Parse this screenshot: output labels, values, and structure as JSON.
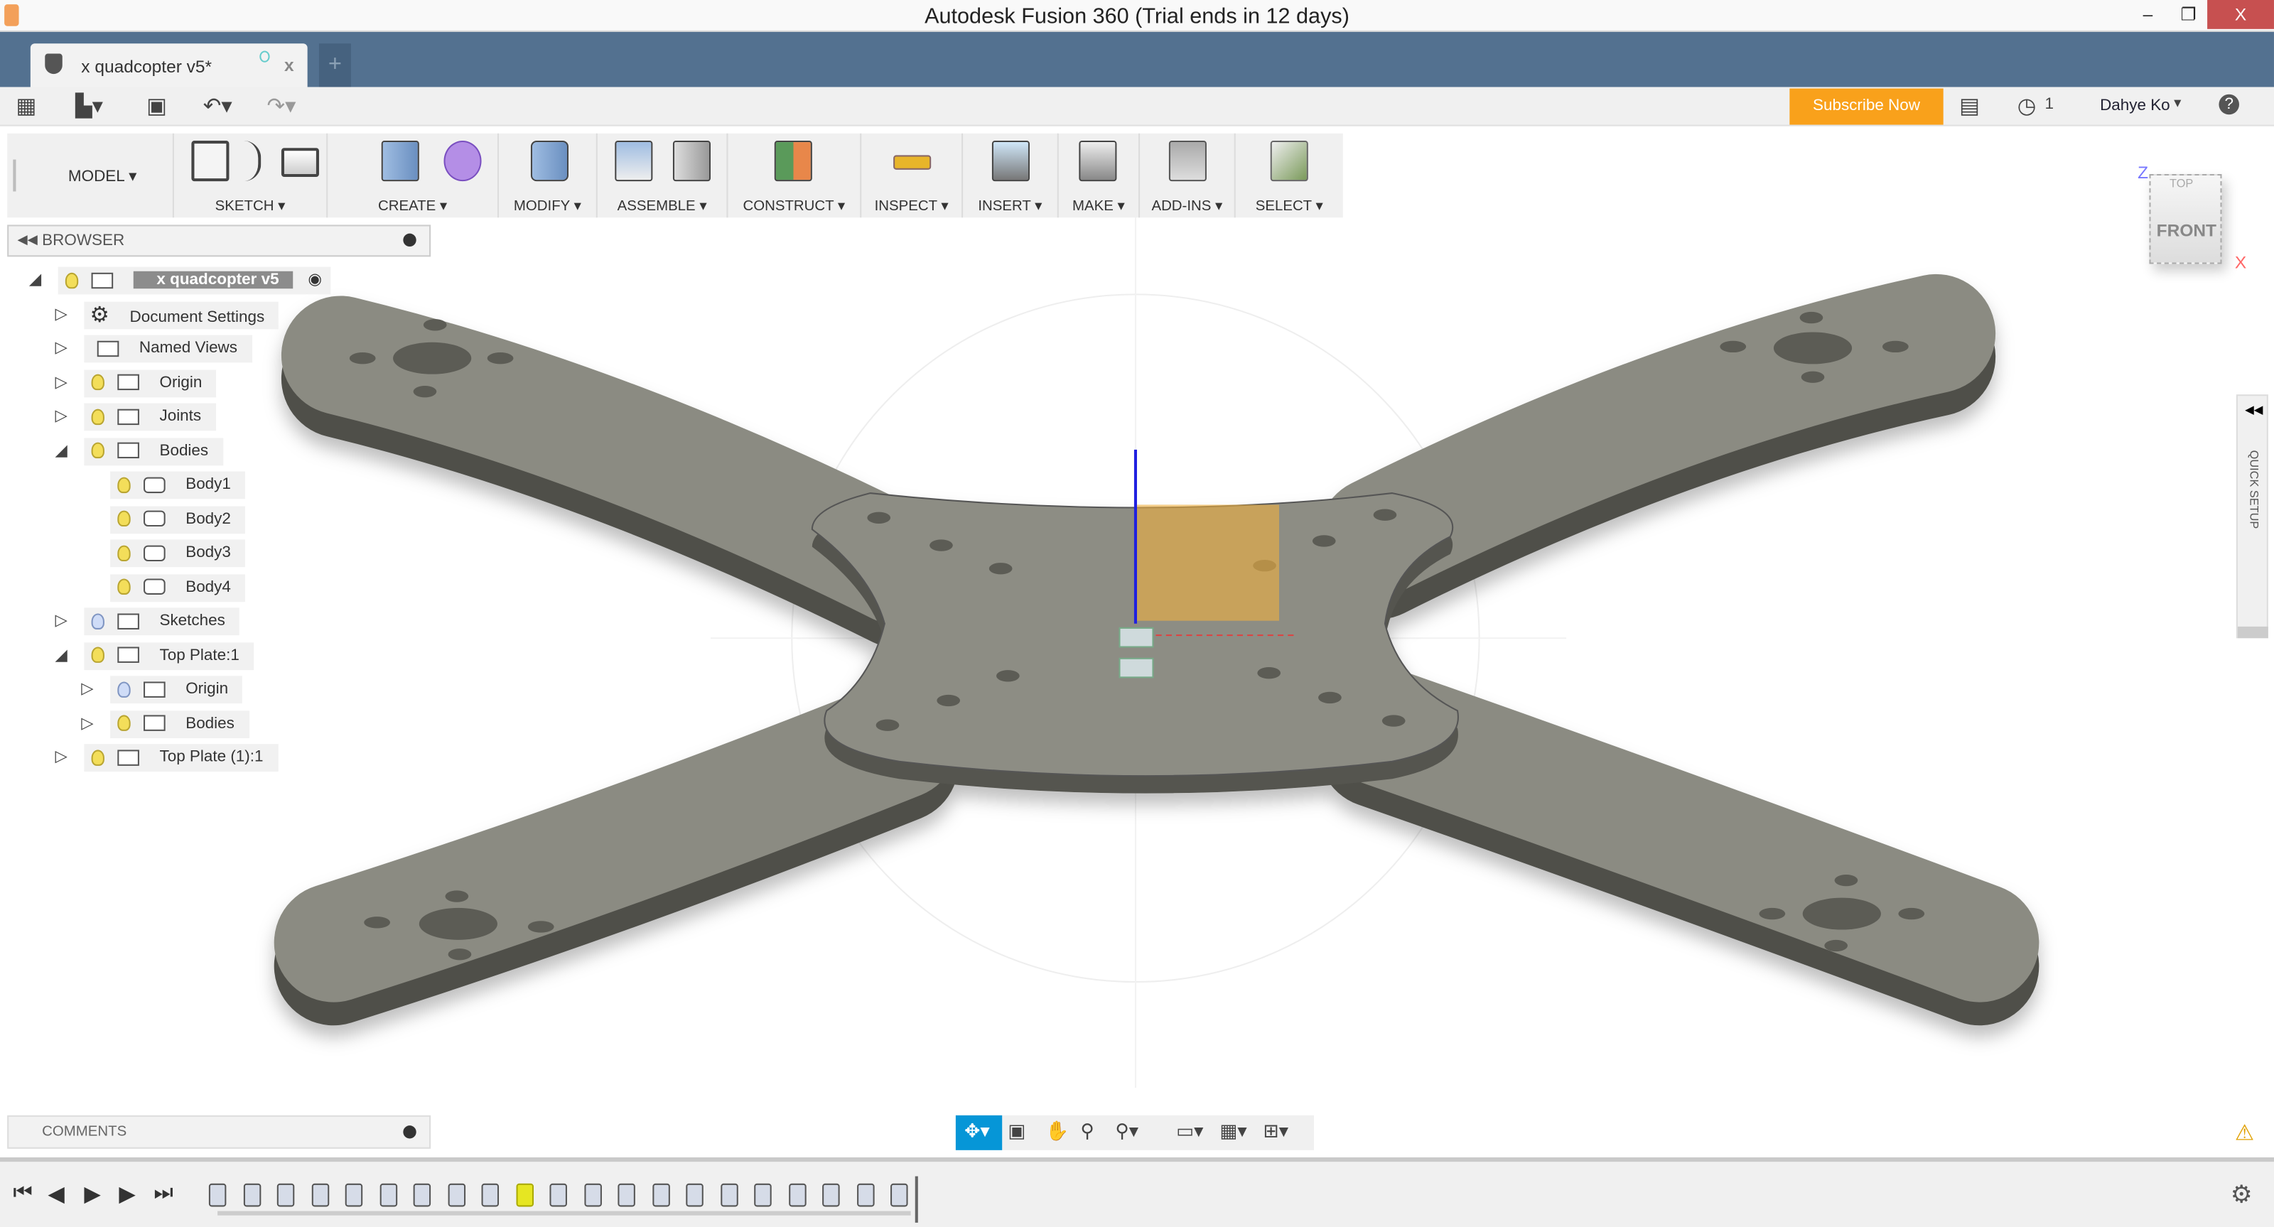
{
  "window": {
    "title": "Autodesk Fusion 360 (Trial ends in 12 days)",
    "minimize": "–",
    "restore": "❐",
    "close": "X"
  },
  "tab": {
    "name": "x quadcopter v5*",
    "close": "x",
    "new": "+"
  },
  "toolbar": {
    "subscribe": "Subscribe Now",
    "jobs_count": "1",
    "user": "Dahye Ko",
    "user_caret": "▾",
    "help": "?"
  },
  "ribbon": {
    "workspace": "MODEL",
    "groups": [
      "SKETCH",
      "CREATE",
      "MODIFY",
      "ASSEMBLE",
      "CONSTRUCT",
      "INSPECT",
      "INSERT",
      "MAKE",
      "ADD-INS",
      "SELECT"
    ]
  },
  "browser": {
    "title": "BROWSER",
    "items": [
      {
        "label": "x quadcopter v5",
        "level": 0,
        "expanded": true,
        "visible": true,
        "icon": "component-icon"
      },
      {
        "label": "Document Settings",
        "level": 1,
        "expanded": false,
        "icon": "gear-icon"
      },
      {
        "label": "Named Views",
        "level": 1,
        "expanded": false,
        "icon": "folder-icon"
      },
      {
        "label": "Origin",
        "level": 1,
        "expanded": false,
        "visible": true,
        "icon": "folder-icon"
      },
      {
        "label": "Joints",
        "level": 1,
        "expanded": false,
        "visible": true,
        "icon": "folder-icon"
      },
      {
        "label": "Bodies",
        "level": 1,
        "expanded": true,
        "visible": true,
        "icon": "folder-icon"
      },
      {
        "label": "Body1",
        "level": 2,
        "visible": true,
        "icon": "body-icon"
      },
      {
        "label": "Body2",
        "level": 2,
        "visible": true,
        "icon": "body-icon"
      },
      {
        "label": "Body3",
        "level": 2,
        "visible": true,
        "icon": "body-icon"
      },
      {
        "label": "Body4",
        "level": 2,
        "visible": true,
        "icon": "body-icon"
      },
      {
        "label": "Sketches",
        "level": 1,
        "expanded": false,
        "visible": false,
        "icon": "folder-icon"
      },
      {
        "label": "Top Plate:1",
        "level": 1,
        "expanded": true,
        "visible": true,
        "icon": "component-icon"
      },
      {
        "label": "Origin",
        "level": 2,
        "expanded": false,
        "visible": false,
        "icon": "folder-icon"
      },
      {
        "label": "Bodies",
        "level": 2,
        "expanded": false,
        "visible": true,
        "icon": "folder-icon"
      },
      {
        "label": "Top Plate (1):1",
        "level": 1,
        "expanded": false,
        "visible": true,
        "icon": "component-icon"
      }
    ]
  },
  "viewcube": {
    "top": "TOP",
    "front": "FRONT",
    "z": "Z",
    "x": "X"
  },
  "quick_setup": "QUICK SETUP",
  "comments": {
    "title": "COMMENTS"
  },
  "colors": {
    "tabbar": "#537190",
    "subscribe": "#f9a11b",
    "close": "#c75050",
    "body": "#8b8b82",
    "nav_active": "#0696d7",
    "timeline_marker": "#e6e622"
  }
}
